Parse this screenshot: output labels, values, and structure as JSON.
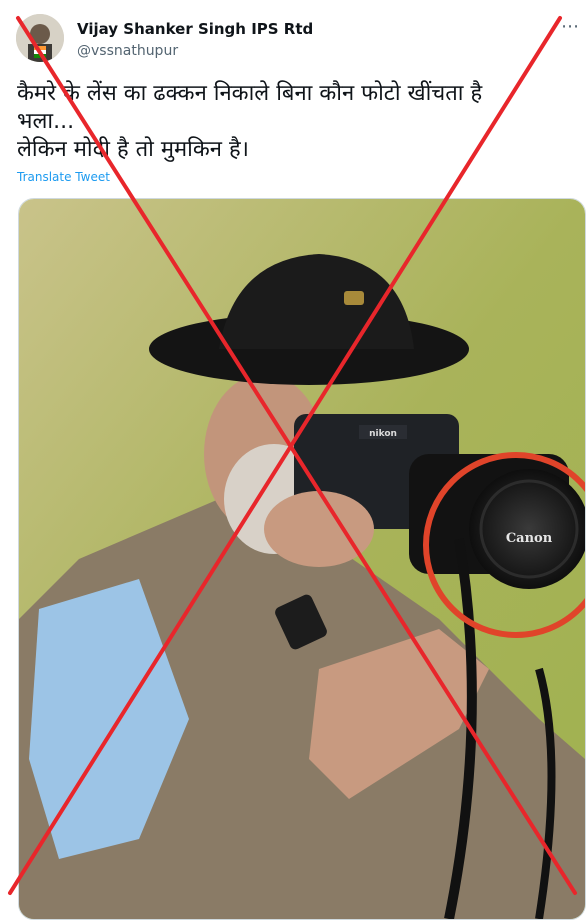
{
  "author": {
    "name": "Vijay Shanker Singh IPS Rtd",
    "handle": "@vssnathupur"
  },
  "tweet": {
    "lines": [
      "कैमरे के लेंस का ढक्कन निकाले बिना  कौन फोटो खींचता है",
      "भला...",
      "लेकिन मोदी है तो मुमकिन है।"
    ],
    "translate_label": "Translate Tweet"
  },
  "photo": {
    "camera_brand": "nikon",
    "lens_cap_brand": "Canon"
  },
  "icons": {
    "more": "more-icon"
  },
  "colors": {
    "cross": "#e8262b",
    "circle": "#e0442a",
    "link": "#1d9bf0"
  }
}
